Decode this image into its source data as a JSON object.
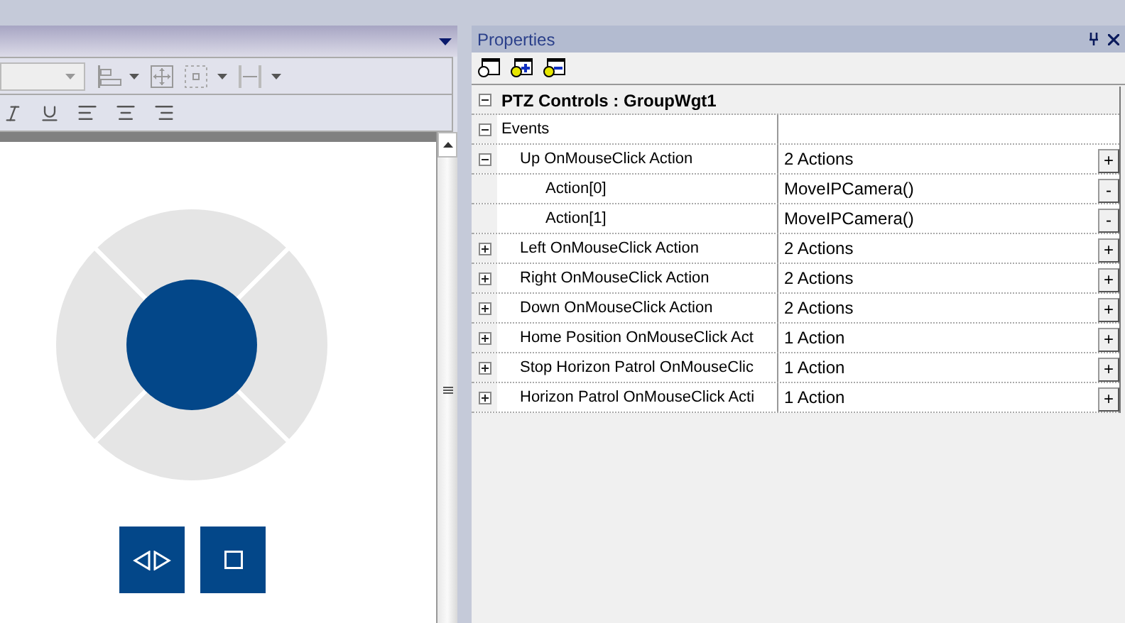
{
  "properties": {
    "title": "Properties",
    "object": {
      "label": "PTZ Controls : GroupWgt1",
      "expanded": true,
      "children": [
        {
          "label": "Events",
          "expanded": true,
          "children": [
            {
              "label": "Up OnMouseClick Action",
              "value": "2 Actions",
              "button": "+",
              "expanded": true,
              "children": [
                {
                  "label": "Action[0]",
                  "value": "MoveIPCamera()",
                  "button": "-"
                },
                {
                  "label": "Action[1]",
                  "value": "MoveIPCamera()",
                  "button": "-"
                }
              ]
            },
            {
              "label": "Left OnMouseClick Action",
              "value": "2 Actions",
              "button": "+",
              "expanded": false
            },
            {
              "label": "Right OnMouseClick Action",
              "value": "2 Actions",
              "button": "+",
              "expanded": false
            },
            {
              "label": "Down OnMouseClick Action",
              "value": "2 Actions",
              "button": "+",
              "expanded": false
            },
            {
              "label": "Home Position OnMouseClick Act",
              "value": "1 Action",
              "button": "+",
              "expanded": false
            },
            {
              "label": "Stop Horizon Patrol OnMouseClic",
              "value": "1 Action",
              "button": "+",
              "expanded": false
            },
            {
              "label": "Horizon Patrol OnMouseClick Acti",
              "value": "1 Action",
              "button": "+",
              "expanded": false
            }
          ]
        }
      ]
    }
  }
}
